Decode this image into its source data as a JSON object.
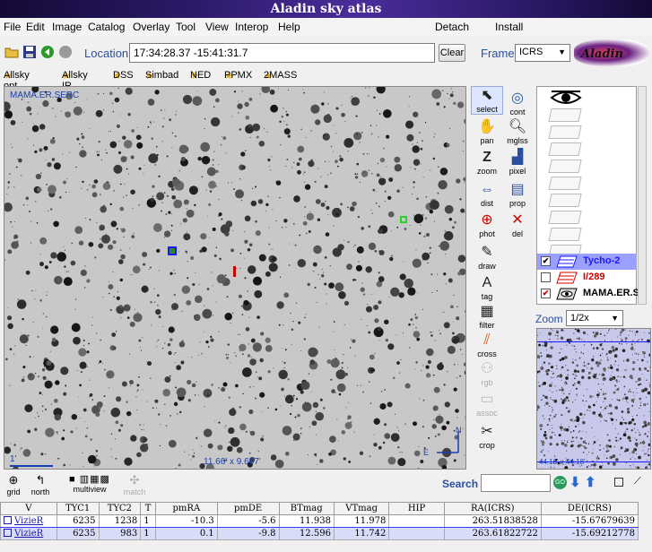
{
  "window": {
    "title": "Aladin sky atlas"
  },
  "menu": {
    "items": [
      "File",
      "Edit",
      "Image",
      "Catalog",
      "Overlay",
      "Tool",
      "View",
      "Interop",
      "Help"
    ],
    "right_items": [
      "Detach",
      "Install"
    ]
  },
  "toolbar": {
    "location_label": "Location",
    "location_value": "17:34:28.37 -15:41:31.7",
    "clear_label": "Clear",
    "frame_label": "Frame",
    "frame_value": "ICRS",
    "logo_text": "Aladin"
  },
  "bookmarks": [
    "Allsky opt",
    "Allsky IR",
    "DSS",
    "Simbad",
    "NED",
    "PPMX",
    "2MASS"
  ],
  "view": {
    "survey_label": "MAMA.ER.SERC",
    "fov_label": "11.66' x 9.667'",
    "scale_label": "1'",
    "compass_n": "N",
    "compass_e": "E"
  },
  "tools": [
    {
      "id": "select",
      "label": "select",
      "icon": "cursor-icon"
    },
    {
      "id": "cont",
      "label": "cont",
      "icon": "contour-icon"
    },
    {
      "id": "pan",
      "label": "pan",
      "icon": "hand-icon"
    },
    {
      "id": "mglss",
      "label": "mglss",
      "icon": "magnifier-icon"
    },
    {
      "id": "zoom",
      "label": "zoom",
      "icon": "zoom-z-icon"
    },
    {
      "id": "pixel",
      "label": "pixel",
      "icon": "histogram-icon"
    },
    {
      "id": "dist",
      "label": "dist",
      "icon": "ruler-icon"
    },
    {
      "id": "prop",
      "label": "prop",
      "icon": "properties-icon"
    },
    {
      "id": "phot",
      "label": "phot",
      "icon": "target-icon"
    },
    {
      "id": "del",
      "label": "del",
      "icon": "delete-x-icon"
    },
    {
      "id": "draw",
      "label": "draw",
      "icon": "pencil-icon"
    },
    {
      "id": "tag",
      "label": "tag",
      "icon": "tag-icon"
    },
    {
      "id": "filter",
      "label": "filter",
      "icon": "filter-icon"
    },
    {
      "id": "cross",
      "label": "cross",
      "icon": "crossmatch-icon"
    },
    {
      "id": "rgb",
      "label": "rgb",
      "icon": "rgb-icon"
    },
    {
      "id": "assoc",
      "label": "assoc",
      "icon": "assoc-icon"
    },
    {
      "id": "crop",
      "label": "crop",
      "icon": "scissors-icon"
    }
  ],
  "layers": [
    {
      "name": "Tycho-2",
      "checked": true,
      "color": "#1a1aff",
      "highlight": true
    },
    {
      "name": "I/289",
      "checked": false,
      "color": "#cc0000",
      "highlight": false
    },
    {
      "name": "MAMA.ER.S",
      "checked": true,
      "color": "#000000",
      "highlight": false
    }
  ],
  "zoom": {
    "label": "Zoom",
    "value": "1/2x",
    "fov_label": "44.16' x 44.18'"
  },
  "bottom": {
    "grid_label": "grid",
    "north_label": "north",
    "multiview_label": "multiview",
    "match_label": "match",
    "search_label": "Search",
    "search_value": ""
  },
  "table": {
    "columns": [
      "V",
      "TYC1",
      "TYC2",
      "T",
      "pmRA",
      "pmDE",
      "BTmag",
      "VTmag",
      "HIP",
      "RA(ICRS)",
      "DE(ICRS)"
    ],
    "rows": [
      [
        "VizieR",
        "6235",
        "1238",
        "1",
        "-10.3",
        "-5.6",
        "11.938",
        "11.978",
        "",
        "263.51838528",
        "-15.67679639"
      ],
      [
        "VizieR",
        "6235",
        "983",
        "1",
        "0.1",
        "-9.8",
        "12.596",
        "11.742",
        "",
        "263.61822722",
        "-15.69212778"
      ]
    ]
  },
  "colors": {
    "accent": "#2a4fa0",
    "title_bg": "#2c1a6a",
    "selection": "#3a3aff"
  }
}
